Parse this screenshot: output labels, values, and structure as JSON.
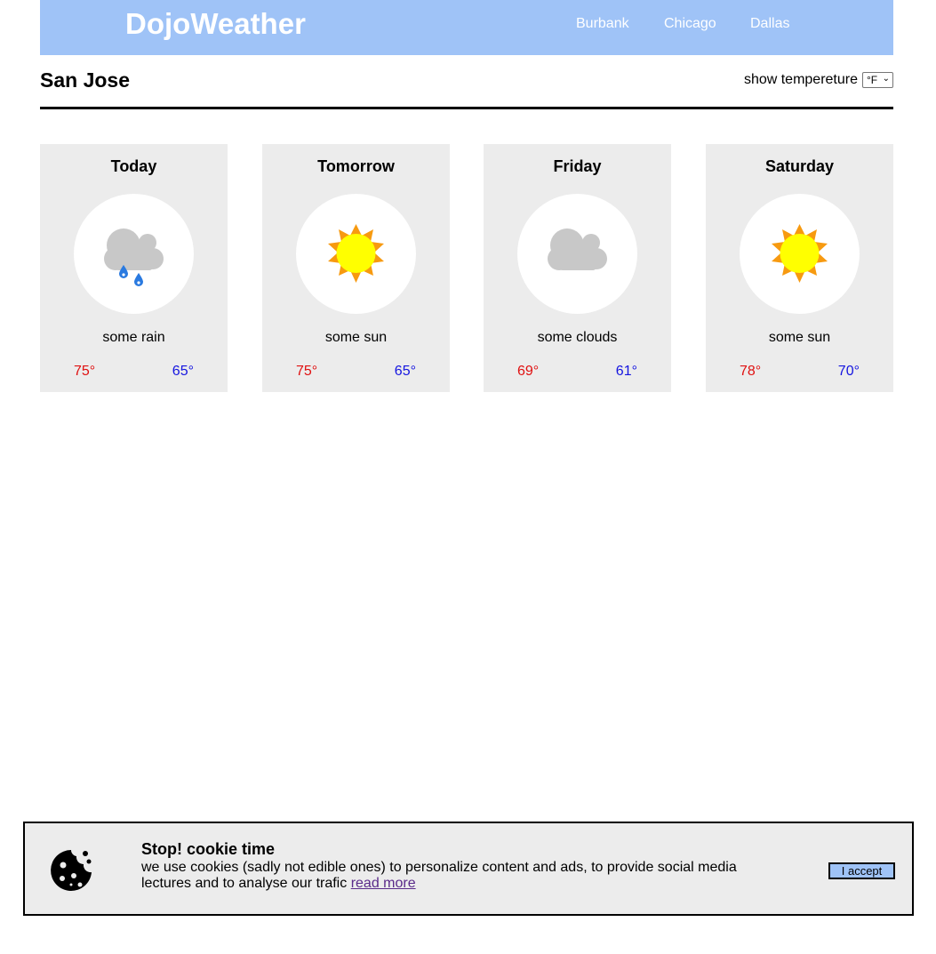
{
  "header": {
    "brand": "DojoWeather",
    "nav": [
      "Burbank",
      "Chicago",
      "Dallas"
    ],
    "background": "#9fc3f7"
  },
  "city": {
    "name": "San Jose",
    "temp_label": "show tempereture",
    "temp_unit": "°F"
  },
  "forecast": [
    {
      "day": "Today",
      "desc": "some rain",
      "high": "75°",
      "low": "65°",
      "icon": "rain-cloud-icon"
    },
    {
      "day": "Tomorrow",
      "desc": "some sun",
      "high": "75°",
      "low": "65°",
      "icon": "sun-icon"
    },
    {
      "day": "Friday",
      "desc": "some clouds",
      "high": "69°",
      "low": "61°",
      "icon": "cloud-icon"
    },
    {
      "day": "Saturday",
      "desc": "some sun",
      "high": "78°",
      "low": "70°",
      "icon": "sun-icon"
    }
  ],
  "colors": {
    "high_temp": "#e01010",
    "low_temp": "#1515e0",
    "card_bg": "#ececec"
  },
  "cookie": {
    "title": "Stop! cookie time",
    "text": "we use cookies (sadly not edible ones) to personalize content and ads, to provide social media lectures and to analyse our trafic",
    "link": "read more",
    "accept": "I accept",
    "icon": "cookie-icon"
  }
}
